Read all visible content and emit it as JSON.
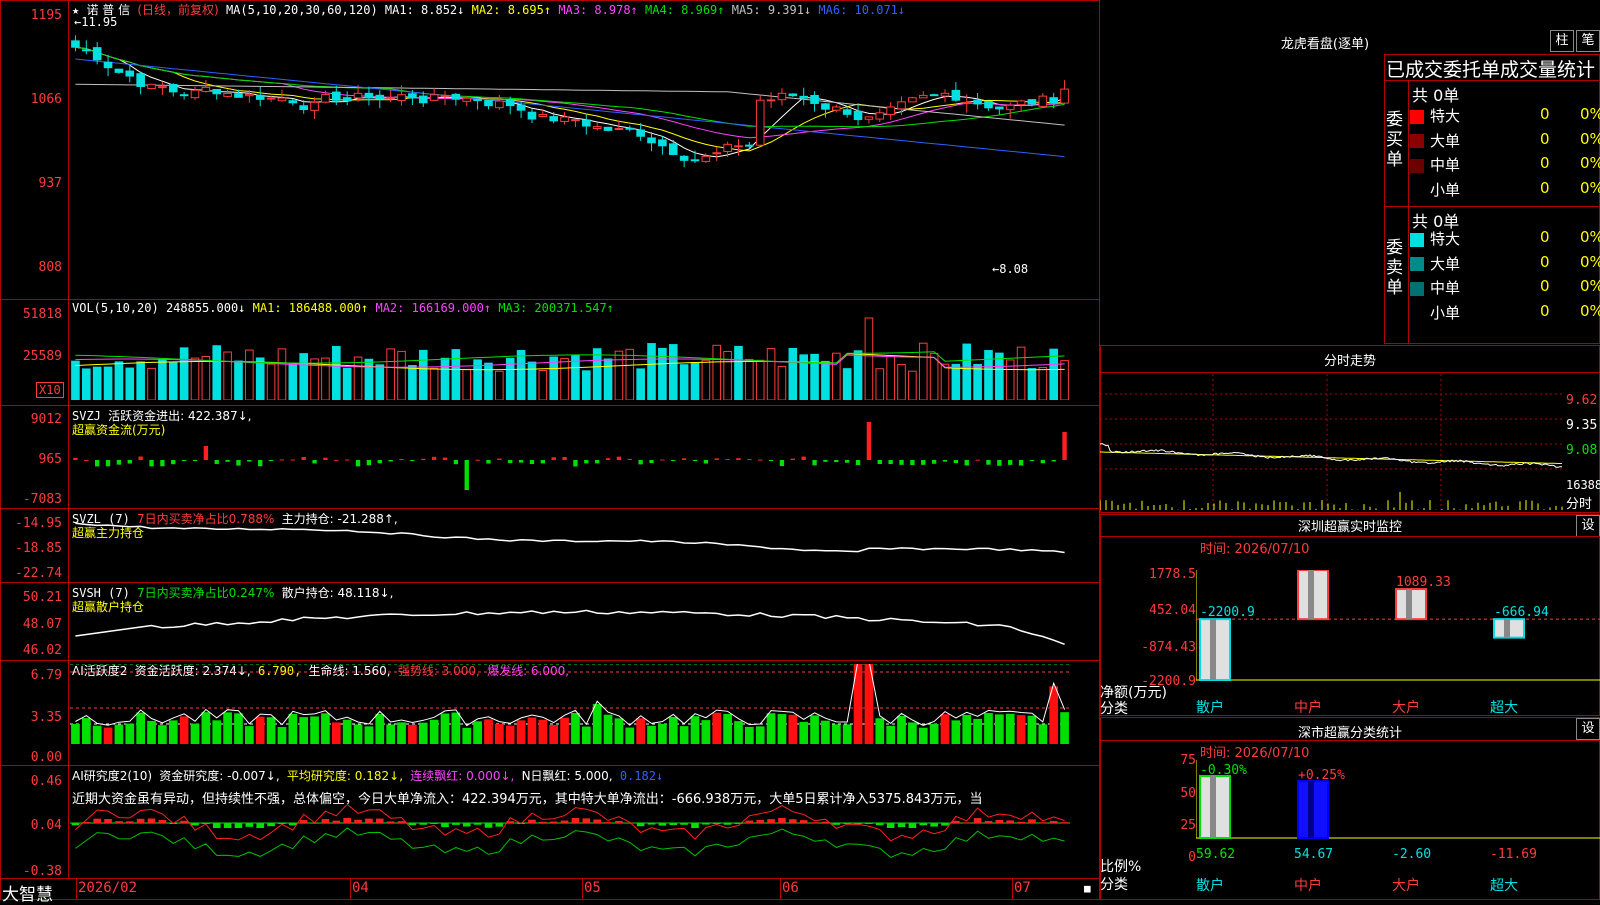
{
  "stock": {
    "name": "诺 普 信",
    "period": "(日线，前复权)"
  },
  "price_axis": [
    "1195",
    "1066",
    "937",
    "808"
  ],
  "ma_header": {
    "label": "MA(5,10,20,30,60,120)",
    "items": [
      {
        "text": "MA1: 8.852↓",
        "color": "#ffffff"
      },
      {
        "text": "MA2: 8.695↑",
        "color": "#ffff00"
      },
      {
        "text": "MA3: 8.978↑",
        "color": "#ff44ff"
      },
      {
        "text": "MA4: 8.969↑",
        "color": "#00e000"
      },
      {
        "text": "MA5: 9.391↓",
        "color": "#c0c0c0"
      },
      {
        "text": "MA6: 10.071↓",
        "color": "#3060ff"
      }
    ]
  },
  "annotations": {
    "high": "←11.95",
    "low": "←8.08"
  },
  "vol": {
    "axis": [
      "51818",
      "25589"
    ],
    "unit": "X10",
    "label": "VOL(5,10,20)",
    "value": "248855.000↓",
    "ma1": "MA1: 186488.000↑",
    "ma2": "MA2: 166169.000↑",
    "ma3": "MA3: 200371.547↑"
  },
  "svzj": {
    "axis": [
      "9012",
      "965",
      "-7083"
    ],
    "label": "SVZJ",
    "desc": "活跃资金进出: 422.387↓,",
    "sub": "超赢资金流(万元)"
  },
  "svzl": {
    "axis": [
      "-14.95",
      "-18.85",
      "-22.74"
    ],
    "label": "SVZL (7)",
    "desc": "7日内买卖净占比0.788%",
    "value": "主力持仓: -21.288↑,",
    "sub": "超赢主力持仓"
  },
  "svsh": {
    "axis": [
      "50.21",
      "48.07",
      "46.02"
    ],
    "label": "SVSH (7)",
    "desc": "7日内买卖净占比0.247%",
    "value": "散户持仓: 48.118↓,",
    "sub": "超赢散户持仓"
  },
  "ai1": {
    "axis": [
      "6.79",
      "3.35",
      "0.00"
    ],
    "label": "AI活跃度2",
    "v1": "资金活跃度: 2.374↓,",
    "v2": "6.790,",
    "v3": "生命线: 1.560,",
    "v4": "强势线: 3.000,",
    "v5": "爆发线: 6.000,"
  },
  "ai2": {
    "axis": [
      "0.46",
      "0.04",
      "-0.38"
    ],
    "label": "AI研究度2(10)",
    "v1": "资金研究度: -0.007↓,",
    "v2": "平均研究度: 0.182↓,",
    "v3": "连续飘红: 0.000↓,",
    "v4": "N日飘红: 5.000,",
    "v5": "0.182↓",
    "summary": "近期大资金虽有异动，但持续性不强，总体偏空，今日大单净流入：422.394万元，其中特大单净流出：-666.938万元，大单5日累计净入5375.843万元，当"
  },
  "bottom": {
    "brand": "大智慧",
    "dates": [
      "2026/02",
      "04",
      "05",
      "06",
      "07"
    ]
  },
  "dragon": {
    "title": "龙虎看盘(逐单)",
    "btn1": "柱",
    "btn2": "笔",
    "header": "已成交委托单成交量统计",
    "buy_label": "委买单",
    "sell_label": "委卖单",
    "buy_total": "共 0单",
    "sell_total": "共 0单",
    "rows": [
      {
        "label": "特大",
        "v": "0",
        "p": "0%"
      },
      {
        "label": "大单",
        "v": "0",
        "p": "0%"
      },
      {
        "label": "中单",
        "v": "0",
        "p": "0%"
      },
      {
        "label": "小单",
        "v": "0",
        "p": "0%"
      }
    ],
    "buy_colors": [
      "#ff0000",
      "#8b0000",
      "#6a0000",
      "#000000"
    ],
    "sell_colors": [
      "#00e0e0",
      "#008b8b",
      "#007070",
      "#000000"
    ]
  },
  "minute": {
    "title": "分时走势",
    "axis": [
      "9.62",
      "9.35",
      "9.08",
      "16388",
      "分时"
    ]
  },
  "sz_monitor": {
    "title": "深圳超赢实时监控",
    "btn": "设",
    "time": "时间: 2026/07/10",
    "axis": [
      "1778.5",
      "452.04",
      "-874.43",
      "-2200.9"
    ],
    "ylabel": "净额(万元)",
    "xlabel": "分类",
    "cats": [
      "散户",
      "中户",
      "大户",
      "超大"
    ],
    "values": [
      -2200.9,
      1778.5,
      1089.33,
      -666.94
    ],
    "labels": [
      "-2200.9",
      "1778.5",
      "1089.33",
      "-666.94"
    ]
  },
  "sz_class": {
    "title": "深市超赢分类统计",
    "btn": "设",
    "time": "时间: 2026/07/10",
    "axis": [
      "75",
      "50",
      "25",
      "0"
    ],
    "ylabel": "比例%",
    "xlabel": "分类",
    "cats": [
      "散户",
      "中户",
      "大户",
      "超大"
    ],
    "top_labels": [
      "-0.30%",
      "+0.25%"
    ],
    "bottom_values": [
      "59.62",
      "54.67",
      "-2.60",
      "-11.69"
    ]
  }
}
